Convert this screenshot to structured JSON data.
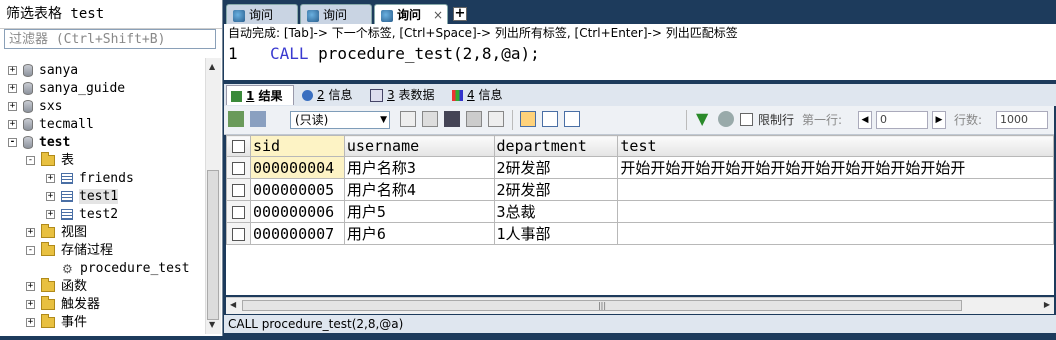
{
  "left_panel": {
    "title": "筛选表格 test",
    "filter_placeholder": "过滤器 (Ctrl+Shift+B)",
    "tree": [
      {
        "label": "sanya",
        "icon": "database-icon",
        "expander": "+"
      },
      {
        "label": "sanya_guide",
        "icon": "database-icon",
        "expander": "+"
      },
      {
        "label": "sxs",
        "icon": "database-icon",
        "expander": "+"
      },
      {
        "label": "tecmall",
        "icon": "database-icon",
        "expander": "+"
      },
      {
        "label": "test",
        "icon": "database-icon",
        "expander": "-"
      },
      {
        "label": "表",
        "icon": "folder-icon",
        "expander": "-"
      },
      {
        "label": "friends",
        "icon": "table-icon",
        "expander": "+"
      },
      {
        "label": "test1",
        "icon": "table-icon",
        "expander": "+"
      },
      {
        "label": "test2",
        "icon": "table-icon",
        "expander": "+"
      },
      {
        "label": "视图",
        "icon": "folder-icon",
        "expander": "+"
      },
      {
        "label": "存储过程",
        "icon": "folder-icon",
        "expander": "-"
      },
      {
        "label": "procedure_test",
        "icon": "procedure-icon",
        "expander": ""
      },
      {
        "label": "函数",
        "icon": "folder-icon",
        "expander": "+"
      },
      {
        "label": "触发器",
        "icon": "folder-icon",
        "expander": "+"
      },
      {
        "label": "事件",
        "icon": "folder-icon",
        "expander": "+"
      }
    ]
  },
  "query_tabs": [
    {
      "label": "询问",
      "active": false
    },
    {
      "label": "询问",
      "active": false
    },
    {
      "label": "询问",
      "active": true
    }
  ],
  "new_tab_label": "+",
  "close_label": "×",
  "hint": "自动完成: [Tab]-> 下一个标签, [Ctrl+Space]-> 列出所有标签, [Ctrl+Enter]-> 列出匹配标签",
  "editor": {
    "line_number": "1",
    "keyword": "CALL",
    "rest": " procedure_test(2,8,@a);"
  },
  "result_tabs": [
    {
      "num": "1",
      "label": "结果",
      "active": true
    },
    {
      "num": "2",
      "label": "信息",
      "active": false
    },
    {
      "num": "3",
      "label": "表数据",
      "active": false
    },
    {
      "num": "4",
      "label": "信息",
      "active": false
    }
  ],
  "toolbar": {
    "readonly_option": "(只读)",
    "limit_rows_label": "限制行",
    "first_row_label": "第一行:",
    "first_row_value": "0",
    "row_count_label": "行数:",
    "row_count_value": "1000"
  },
  "grid": {
    "columns": [
      "sid",
      "username",
      "department",
      "test"
    ],
    "rows": [
      [
        "000000004",
        "用户名称3",
        "2研发部",
        "开始开始开始开始开始开始开始开始开始开始开始开"
      ],
      [
        "000000005",
        "用户名称4",
        "2研发部",
        ""
      ],
      [
        "000000006",
        "用户5",
        "3总裁",
        ""
      ],
      [
        "000000007",
        "用户6",
        "1人事部",
        ""
      ]
    ]
  },
  "status": "CALL procedure_test(2,8,@a)"
}
